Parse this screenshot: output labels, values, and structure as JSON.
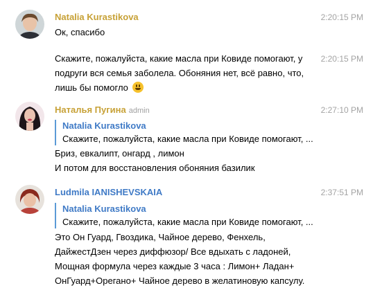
{
  "messages": [
    {
      "author": "Natalia Kurastikova",
      "author_color": "#c7a136",
      "time": "2:20:15 PM",
      "text_lines": [
        "Ок, спасибо"
      ]
    },
    {
      "time": "2:20:15 PM",
      "text_lines": [
        "Скажите, пожалуйста, какие масла при Ковиде помогают, у",
        "подруги вся семья заболела. Обоняния нет, всё равно, что,",
        "лишь бы помогло"
      ],
      "emoji": "grinning-face"
    },
    {
      "author": "Наталья Пугина",
      "author_color": "#c7a136",
      "role": "admin",
      "time": "2:27:10 PM",
      "reply": {
        "name": "Natalia Kurastikova",
        "text": "Скажите, пожалуйста, какие масла при Ковиде помогают, ..."
      },
      "text_lines": [
        "Бриз, евкалипт, онгард , лимон",
        "И потом для восстановления обоняния базилик"
      ]
    },
    {
      "author": "Ludmila IANISHEVSKAIA",
      "author_color": "#3f7ac6",
      "time": "2:37:51 PM",
      "reply": {
        "name": "Natalia Kurastikova",
        "text": "Скажите, пожалуйста, какие масла при Ковиде помогают, ..."
      },
      "text_lines": [
        "Это Он Гуард,  Гвоздика, Чайное дерево, Фенхель,",
        "ДайжестДзен через диффюзор/ Все вдыхать  с ладоней,",
        "Мощная формула через каждые 3 часа : Лимон+ Ладан+",
        "ОнГуард+Орегано+ Чайное дерево в желатиновую капсулу."
      ]
    }
  ],
  "colors": {
    "reply_bar": "#5b9ad6",
    "timestamp": "#a3a3a3"
  }
}
